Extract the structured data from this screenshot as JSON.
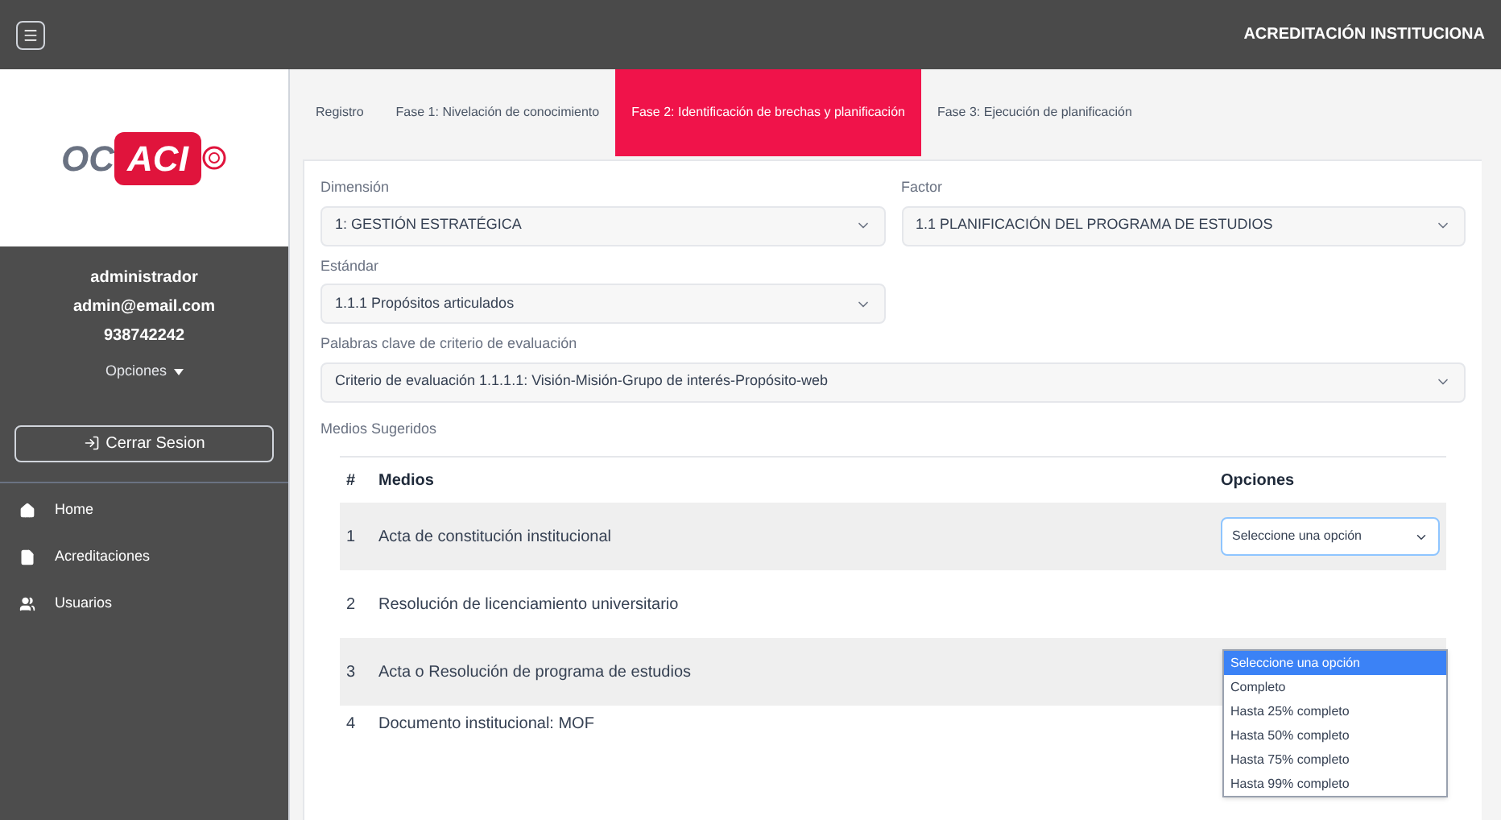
{
  "topbar": {
    "title": "ACREDITACIÓN INSTITUCIONA"
  },
  "sidebar": {
    "logo": {
      "left": "OC",
      "main": "ACI"
    },
    "user": {
      "name": "administrador",
      "email": "admin@email.com",
      "phone": "938742242"
    },
    "options_label": "Opciones",
    "logout": "Cerrar Sesion",
    "items": [
      {
        "kind": "home",
        "label": "Home"
      },
      {
        "kind": "document",
        "label": "Acreditaciones"
      },
      {
        "kind": "users",
        "label": "Usuarios"
      }
    ]
  },
  "tabs": [
    {
      "label": "Registro",
      "selected": false
    },
    {
      "label": "Fase 1: Nivelación de conocimiento",
      "selected": false
    },
    {
      "label": "Fase 2: Identificación de brechas y planificación",
      "selected": true
    },
    {
      "label": "Fase 3: Ejecución de planificación",
      "selected": false
    }
  ],
  "form": {
    "dimension": {
      "label": "Dimensión",
      "value": "1: GESTIÓN ESTRATÉGICA"
    },
    "factor": {
      "label": "Factor",
      "value": "1.1 PLANIFICACIÓN DEL PROGRAMA DE ESTUDIOS"
    },
    "standard": {
      "label": "Estándar",
      "value": "1.1.1 Propósitos articulados"
    },
    "keywords": {
      "label": "Palabras clave de criterio de evaluación",
      "value": "Criterio de evaluación 1.1.1.1: Visión-Misión-Grupo de interés-Propósito-web"
    }
  },
  "media": {
    "title": "Medios Sugeridos",
    "columns": [
      "#",
      "Medios",
      "Opciones"
    ],
    "rows": [
      {
        "number": "1",
        "name": "Acta de constitución institucional",
        "select": "Seleccione una opción"
      },
      {
        "number": "2",
        "name": "Resolución de licenciamiento universitario"
      },
      {
        "number": "3",
        "name": "Acta o Resolución de programa de estudios"
      },
      {
        "number": "4",
        "name": "Documento institucional: MOF"
      }
    ],
    "dropdown": [
      {
        "label": "Seleccione una opción",
        "selected": true
      },
      {
        "label": "Completo",
        "selected": false
      },
      {
        "label": "Hasta 25% completo",
        "selected": false
      },
      {
        "label": "Hasta 50% completo",
        "selected": false
      },
      {
        "label": "Hasta 75% completo",
        "selected": false
      },
      {
        "label": "Hasta 99% completo",
        "selected": false
      }
    ]
  }
}
